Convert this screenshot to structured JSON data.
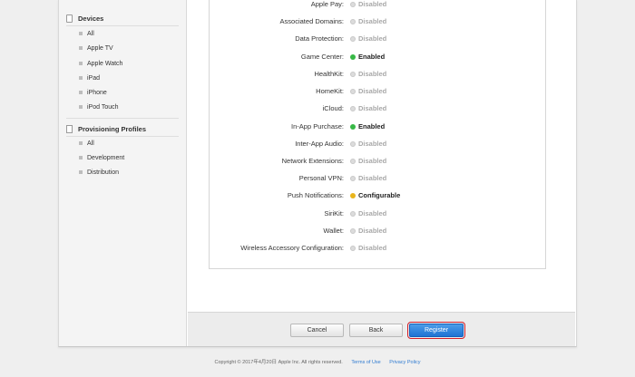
{
  "sidebar": {
    "devices": {
      "title": "Devices",
      "items": [
        "All",
        "Apple TV",
        "Apple Watch",
        "iPad",
        "iPhone",
        "iPod Touch"
      ]
    },
    "profiles": {
      "title": "Provisioning Profiles",
      "items": [
        "All",
        "Development",
        "Distribution"
      ]
    }
  },
  "services": [
    {
      "label": "Apple Pay:",
      "status": "Disabled",
      "state": "disabled"
    },
    {
      "label": "Associated Domains:",
      "status": "Disabled",
      "state": "disabled"
    },
    {
      "label": "Data Protection:",
      "status": "Disabled",
      "state": "disabled"
    },
    {
      "label": "Game Center:",
      "status": "Enabled",
      "state": "enabled"
    },
    {
      "label": "HealthKit:",
      "status": "Disabled",
      "state": "disabled"
    },
    {
      "label": "HomeKit:",
      "status": "Disabled",
      "state": "disabled"
    },
    {
      "label": "iCloud:",
      "status": "Disabled",
      "state": "disabled"
    },
    {
      "label": "In-App Purchase:",
      "status": "Enabled",
      "state": "enabled"
    },
    {
      "label": "Inter-App Audio:",
      "status": "Disabled",
      "state": "disabled"
    },
    {
      "label": "Network Extensions:",
      "status": "Disabled",
      "state": "disabled"
    },
    {
      "label": "Personal VPN:",
      "status": "Disabled",
      "state": "disabled"
    },
    {
      "label": "Push Notifications:",
      "status": "Configurable",
      "state": "configurable"
    },
    {
      "label": "SiriKit:",
      "status": "Disabled",
      "state": "disabled"
    },
    {
      "label": "Wallet:",
      "status": "Disabled",
      "state": "disabled"
    },
    {
      "label": "Wireless Accessory Configuration:",
      "status": "Disabled",
      "state": "disabled"
    }
  ],
  "buttons": {
    "cancel": "Cancel",
    "back": "Back",
    "register": "Register"
  },
  "footer": {
    "copyright": "Copyright © 2017年4月20日 Apple Inc. All rights reserved.",
    "terms": "Terms of Use",
    "privacy": "Privacy Policy"
  },
  "colors": {
    "enabled": "#37b846",
    "configurable": "#e9b51c",
    "disabled": "#dcdcdc",
    "primary_button": "#1f73d3",
    "highlight_outline": "#d3202a"
  }
}
